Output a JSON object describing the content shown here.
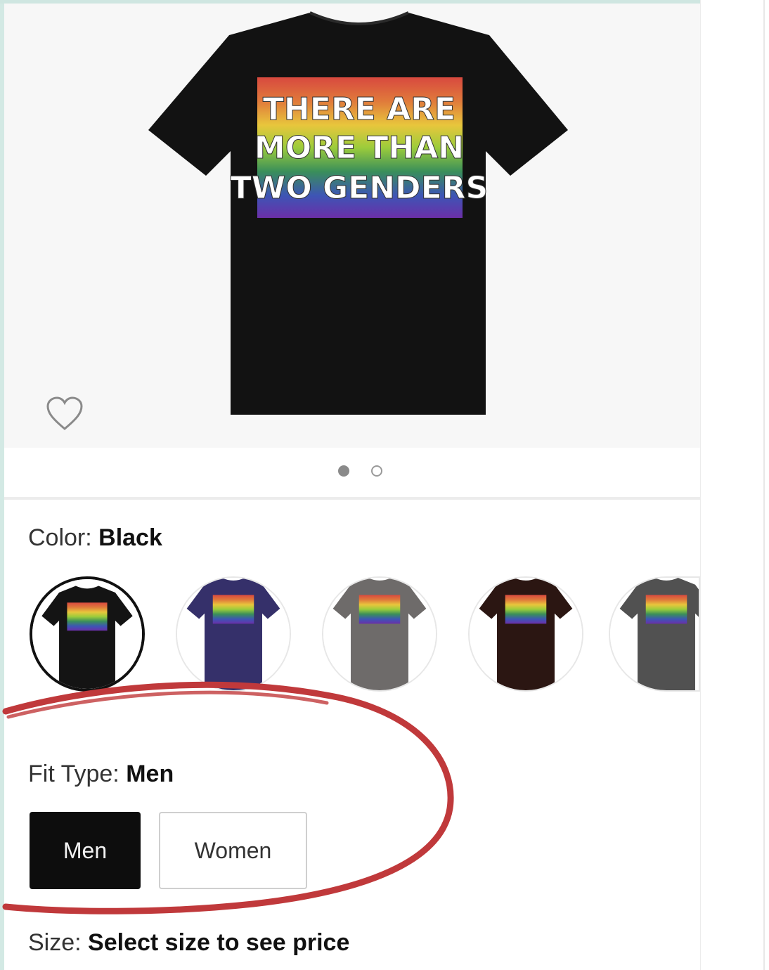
{
  "product_image": {
    "shirt_text_lines": [
      "THERE ARE",
      "MORE THAN",
      "TWO GENDERS"
    ],
    "shirt_color": "#121212",
    "carousel": {
      "total_images": 2,
      "active_index": 1
    }
  },
  "color_selector": {
    "label": "Color: ",
    "selected_value": "Black",
    "swatches": [
      {
        "name": "black",
        "color": "#141414",
        "selected": true
      },
      {
        "name": "navy",
        "color": "#35306a",
        "selected": false
      },
      {
        "name": "gray",
        "color": "#6e6b6a",
        "selected": false
      },
      {
        "name": "brown",
        "color": "#2b1612",
        "selected": false
      },
      {
        "name": "dark-heather",
        "color": "#515151",
        "selected": false
      }
    ]
  },
  "fit_type": {
    "label": "Fit Type: ",
    "selected_value": "Men",
    "options": [
      "Men",
      "Women"
    ]
  },
  "size": {
    "label": "Size: ",
    "value": "Select size to see price"
  },
  "annotation_color": "#c0393b",
  "icons": {
    "wishlist": "heart-icon"
  }
}
